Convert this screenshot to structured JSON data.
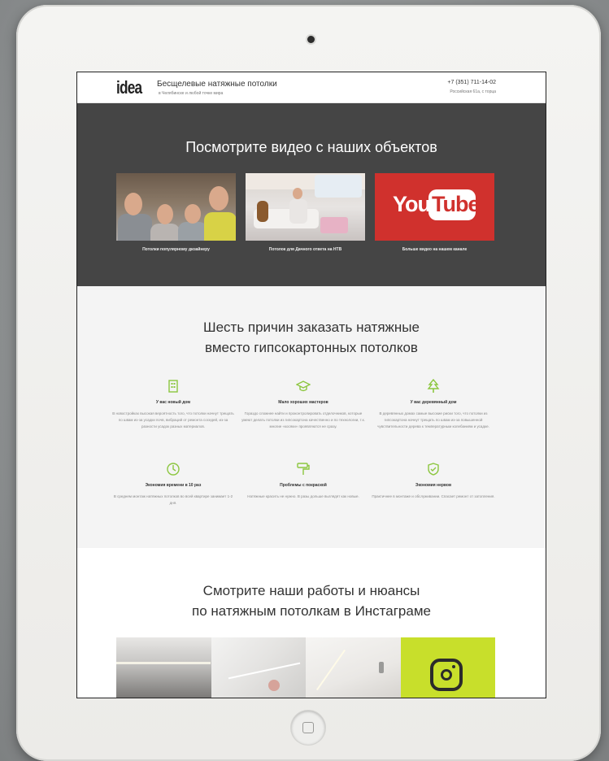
{
  "header": {
    "logo_text": "idea",
    "site_title": "Бесщелевые натяжные потолки",
    "site_subtitle": "в Челябинске и любой точке мира",
    "phone": "+7 (351) 711-14-02",
    "address": "Российская 61а, с торца"
  },
  "video_section": {
    "heading": "Посмотрите видео с наших объектов",
    "cards": [
      {
        "caption": "Потолки популярному дизайнеру",
        "thumb": "group-selfie-photo"
      },
      {
        "caption": "Потолок для Дачного ответа на НТВ",
        "thumb": "living-room-photo"
      },
      {
        "caption": "Больше видео на нашем канале",
        "thumb": "youtube-logo"
      }
    ],
    "youtube_you": "You",
    "youtube_tube": "Tube"
  },
  "reasons_section": {
    "heading_line1": "Шесть причин заказать натяжные",
    "heading_line2": "вместо гипсокартонных потолков",
    "items": [
      {
        "icon": "building-icon",
        "title": "У вас новый дом",
        "text": "В новостройках высокая вероятность того, что потолки начнут трещать по швам из-за усадки почв, вибраций от ремонта соседей, из-за разности усадок разных материалов."
      },
      {
        "icon": "graduation-cap-icon",
        "title": "Мало хороших мастеров",
        "text": "Гораздо сложнее найти и проконтролировать отделочников, которые умеют делать потолки из гипсокартона качественно и по технологии, т.к. многие «косяки» проявляются не сразу."
      },
      {
        "icon": "tree-icon",
        "title": "У вас деревянный дом",
        "text": "В деревянных домах самые высокие риски того, что потолки из гипсокартона начнут трещать по швам из-за повышенной чувствительности дерева к температурным колебаниям и усадке."
      },
      {
        "icon": "clock-icon",
        "title": "Экономия времени в 10 раз",
        "text": "В среднем монтаж натяжных потолков во всей квартире занимает 1-2 дня."
      },
      {
        "icon": "paint-roller-icon",
        "title": "Проблемы с покраской",
        "text": "Натяжные красить не нужно. В разы дольше выглядят как новые."
      },
      {
        "icon": "shield-icon",
        "title": "Экономия нервов",
        "text": "Практичнее в монтаже и обслуживании. Спасает ремонт от затопления."
      }
    ]
  },
  "instagram_section": {
    "heading_line1": "Смотрите наши работы и нюансы",
    "heading_line2": "по натяжным потолкам в Инстаграме",
    "tiles": [
      "ceiling-photo-1",
      "ceiling-photo-2",
      "ceiling-photo-3",
      "instagram-icon"
    ]
  },
  "colors": {
    "accent_green": "#8cc63f",
    "video_bg": "#454545",
    "youtube_red": "#d0312d",
    "instagram_tile": "#c8df2b"
  }
}
